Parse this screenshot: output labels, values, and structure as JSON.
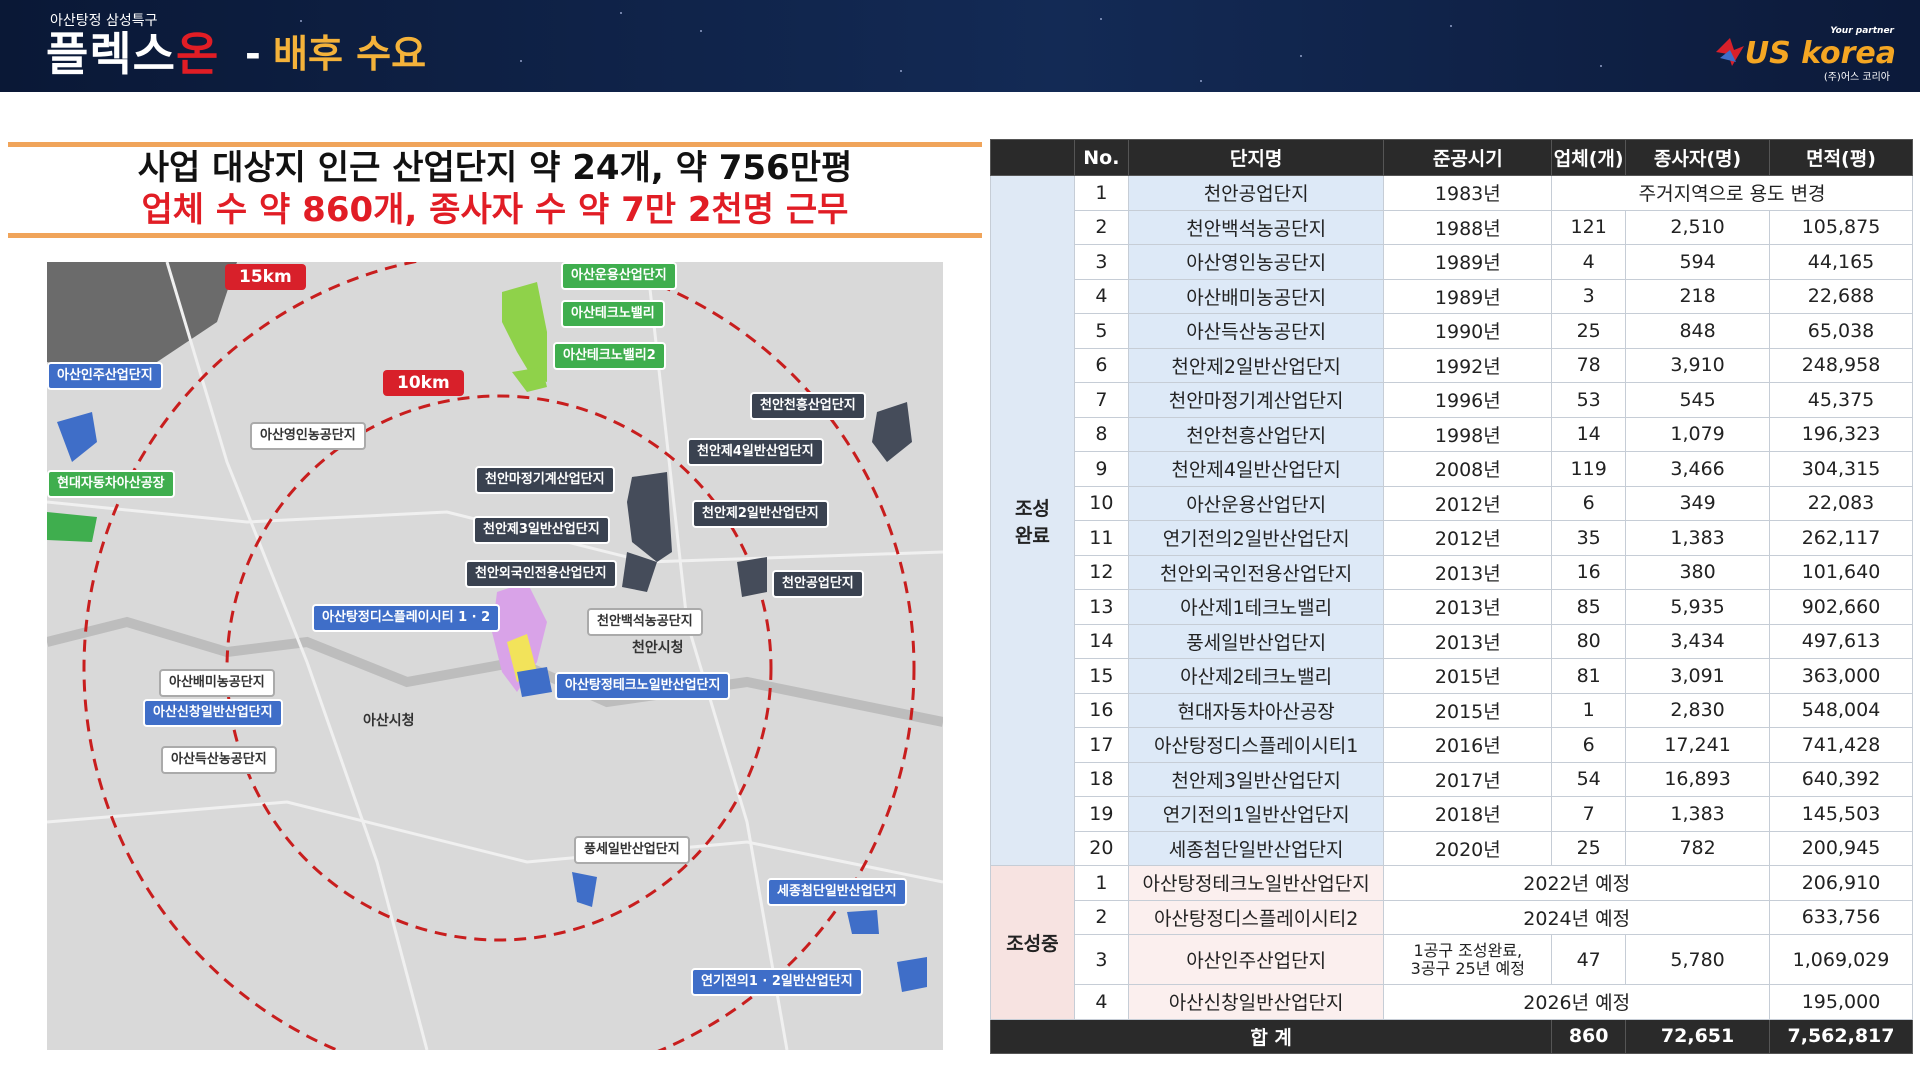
{
  "header": {
    "subtitle": "아산탕정 삼성특구",
    "title_main": "플렉스",
    "title_accent": "온",
    "dash": "-",
    "section": "배후 수요",
    "logo_partner": "Your partner",
    "logo_brand": "US korea",
    "logo_corp": "(주)어스 코리아"
  },
  "headline": {
    "line1": "사업 대상지 인근 산업단지 약 24개, 약 756만평",
    "line2": "업체 수 약 860개, 종사자 수 약 7만 2천명 근무"
  },
  "map": {
    "radius_outer": "15km",
    "radius_inner": "10km",
    "labels": {
      "a1": "아산운용산업단지",
      "a2": "아산테크노밸리",
      "a3": "아산테크노밸리2",
      "a4": "아산인주산업단지",
      "a5": "아산영인농공단지",
      "a6": "현대자동차아산공장",
      "a7": "천안천흥산업단지",
      "a8": "천안제4일반산업단지",
      "a9": "천안마정기계산업단지",
      "a10": "천안제2일반산업단지",
      "a11": "천안제3일반산업단지",
      "a12": "천안외국인전용산업단지",
      "a13": "천안공업단지",
      "a14": "아산탕정디스플레이시티 1 · 2",
      "a15": "천안백석농공단지",
      "a16": "아산배미농공단지",
      "a17": "아산신창일반산업단지",
      "a18": "아산탕정테크노일반산업단지",
      "a19": "아산득산농공단지",
      "a20": "풍세일반산업단지",
      "a21": "세종첨단일반산업단지",
      "a22": "연기전의1 · 2일반산업단지"
    },
    "places": {
      "p1": "아산시청",
      "p2": "천안시청"
    }
  },
  "table": {
    "headers": [
      "No.",
      "단지명",
      "준공시기",
      "업체(개)",
      "종사자(명)",
      "면적(평)"
    ],
    "group_done": "조성\n완료",
    "group_dev": "조성중",
    "done_rows": [
      {
        "no": "1",
        "name": "천안공업단지",
        "year": "1983년",
        "note": "주거지역으로 용도 변경",
        "area": ""
      },
      {
        "no": "2",
        "name": "천안백석농공단지",
        "year": "1988년",
        "firms": "121",
        "workers": "2,510",
        "area": "105,875"
      },
      {
        "no": "3",
        "name": "아산영인농공단지",
        "year": "1989년",
        "firms": "4",
        "workers": "594",
        "area": "44,165"
      },
      {
        "no": "4",
        "name": "아산배미농공단지",
        "year": "1989년",
        "firms": "3",
        "workers": "218",
        "area": "22,688"
      },
      {
        "no": "5",
        "name": "아산득산농공단지",
        "year": "1990년",
        "firms": "25",
        "workers": "848",
        "area": "65,038"
      },
      {
        "no": "6",
        "name": "천안제2일반산업단지",
        "year": "1992년",
        "firms": "78",
        "workers": "3,910",
        "area": "248,958"
      },
      {
        "no": "7",
        "name": "천안마정기계산업단지",
        "year": "1996년",
        "firms": "53",
        "workers": "545",
        "area": "45,375"
      },
      {
        "no": "8",
        "name": "천안천흥산업단지",
        "year": "1998년",
        "firms": "14",
        "workers": "1,079",
        "area": "196,323"
      },
      {
        "no": "9",
        "name": "천안제4일반산업단지",
        "year": "2008년",
        "firms": "119",
        "workers": "3,466",
        "area": "304,315"
      },
      {
        "no": "10",
        "name": "아산운용산업단지",
        "year": "2012년",
        "firms": "6",
        "workers": "349",
        "area": "22,083"
      },
      {
        "no": "11",
        "name": "연기전의2일반산업단지",
        "year": "2012년",
        "firms": "35",
        "workers": "1,383",
        "area": "262,117"
      },
      {
        "no": "12",
        "name": "천안외국인전용산업단지",
        "year": "2013년",
        "firms": "16",
        "workers": "380",
        "area": "101,640"
      },
      {
        "no": "13",
        "name": "아산제1테크노밸리",
        "year": "2013년",
        "firms": "85",
        "workers": "5,935",
        "area": "902,660"
      },
      {
        "no": "14",
        "name": "풍세일반산업단지",
        "year": "2013년",
        "firms": "80",
        "workers": "3,434",
        "area": "497,613"
      },
      {
        "no": "15",
        "name": "아산제2테크노밸리",
        "year": "2015년",
        "firms": "81",
        "workers": "3,091",
        "area": "363,000"
      },
      {
        "no": "16",
        "name": "현대자동차아산공장",
        "year": "2015년",
        "firms": "1",
        "workers": "2,830",
        "area": "548,004"
      },
      {
        "no": "17",
        "name": "아산탕정디스플레이시티1",
        "year": "2016년",
        "firms": "6",
        "workers": "17,241",
        "area": "741,428"
      },
      {
        "no": "18",
        "name": "천안제3일반산업단지",
        "year": "2017년",
        "firms": "54",
        "workers": "16,893",
        "area": "640,392"
      },
      {
        "no": "19",
        "name": "연기전의1일반산업단지",
        "year": "2018년",
        "firms": "7",
        "workers": "1,383",
        "area": "145,503"
      },
      {
        "no": "20",
        "name": "세종첨단일반산업단지",
        "year": "2020년",
        "firms": "25",
        "workers": "782",
        "area": "200,945"
      }
    ],
    "dev_rows": [
      {
        "no": "1",
        "name": "아산탕정테크노일반산업단지",
        "plan": "2022년 예정",
        "area": "206,910"
      },
      {
        "no": "2",
        "name": "아산탕정디스플레이시티2",
        "plan": "2024년 예정",
        "area": "633,756"
      },
      {
        "no": "3",
        "name": "아산인주산업단지",
        "year_l1": "1공구 조성완료,",
        "year_l2": "3공구 25년 예정",
        "firms": "47",
        "workers": "5,780",
        "area": "1,069,029"
      },
      {
        "no": "4",
        "name": "아산신창일반산업단지",
        "plan": "2026년 예정",
        "area": "195,000"
      }
    ],
    "total": {
      "label": "합 계",
      "firms": "860",
      "workers": "72,651",
      "area": "7,562,817"
    }
  }
}
